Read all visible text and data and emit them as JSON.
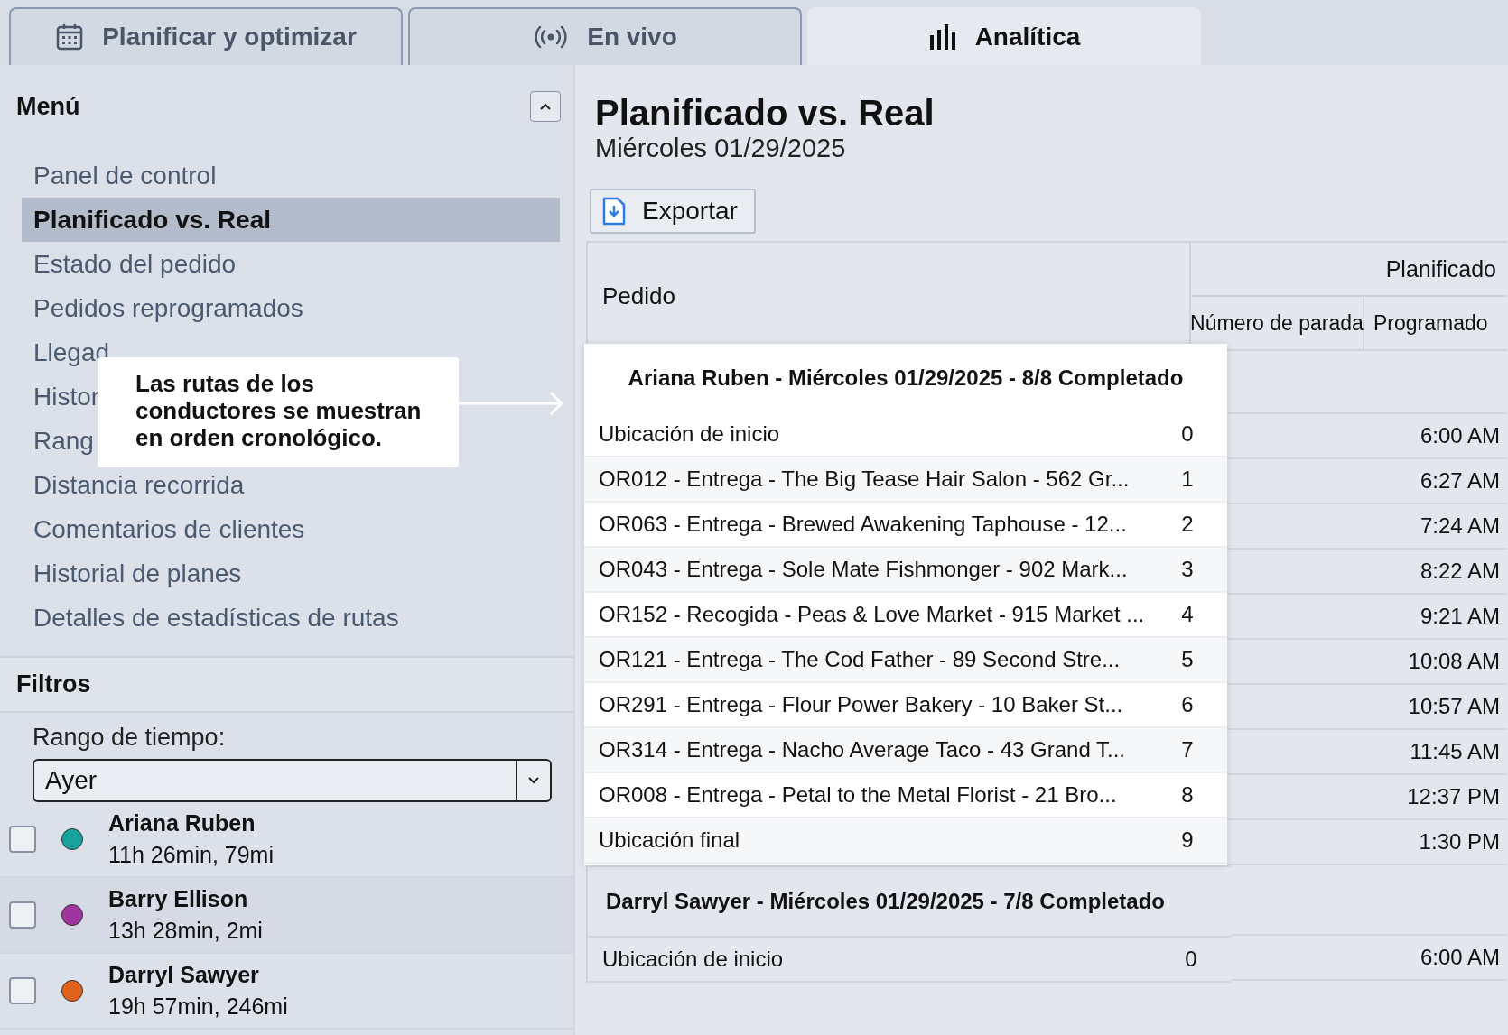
{
  "tabs": [
    {
      "label": "Planificar y optimizar",
      "kind": "calendar",
      "selected": false
    },
    {
      "label": "En vivo",
      "kind": "broadcast",
      "selected": false
    },
    {
      "label": "Analítica",
      "kind": "bars",
      "selected": true
    }
  ],
  "sidebar": {
    "title": "Menú",
    "expanded": true,
    "items": [
      {
        "label": "Panel de control",
        "selected": false
      },
      {
        "label": "Planificado vs. Real",
        "selected": true
      },
      {
        "label": "Estado del pedido",
        "selected": false
      },
      {
        "label": "Pedidos reprogramados",
        "selected": false
      },
      {
        "label": "Llegad",
        "selected": false
      },
      {
        "label": "Histor",
        "selected": false
      },
      {
        "label": "Rang",
        "selected": false
      },
      {
        "label": "Distancia recorrida",
        "selected": false
      },
      {
        "label": "Comentarios de clientes",
        "selected": false
      },
      {
        "label": "Historial de planes",
        "selected": false
      },
      {
        "label": "Detalles de estadísticas de rutas",
        "selected": false
      }
    ],
    "filters": {
      "title": "Filtros",
      "time_range": {
        "label": "Rango de tiempo:",
        "value": "Ayer"
      },
      "drivers": [
        {
          "name": "Ariana Ruben",
          "summary": "11h 26min, 79mi",
          "color": "#17a39c",
          "checked": false
        },
        {
          "name": "Barry Ellison",
          "summary": "13h 28min, 2mi",
          "color": "#a1359f",
          "checked": false
        },
        {
          "name": "Darryl Sawyer",
          "summary": "19h 57min, 246mi",
          "color": "#e0621c",
          "checked": false
        }
      ]
    }
  },
  "callout": {
    "text": "Las rutas de los conductores se muestran en orden cronológico."
  },
  "main": {
    "title": "Planificado vs. Real",
    "subtitle": "Miércoles 01/29/2025",
    "export_button": "Exportar",
    "table": {
      "columns": {
        "order": "Pedido",
        "group": "Planificado",
        "stop": "Número de parada",
        "scheduled": "Programado"
      },
      "groups": [
        {
          "title": "Ariana Ruben - Miércoles 01/29/2025 - 8/8 Completado",
          "highlighted": true,
          "rows": [
            {
              "order": "Ubicación de inicio",
              "stop": "0",
              "time": "6:00 AM"
            },
            {
              "order": "OR012 - Entrega - The Big Tease Hair Salon - 562 Gr...",
              "stop": "1",
              "time": "6:27 AM"
            },
            {
              "order": "OR063 - Entrega - Brewed Awakening Taphouse - 12...",
              "stop": "2",
              "time": "7:24 AM"
            },
            {
              "order": "OR043 - Entrega - Sole Mate Fishmonger - 902 Mark...",
              "stop": "3",
              "time": "8:22 AM"
            },
            {
              "order": "OR152 - Recogida - Peas & Love Market - 915 Market ...",
              "stop": "4",
              "time": "9:21 AM"
            },
            {
              "order": "OR121 - Entrega - The Cod Father - 89 Second Stre...",
              "stop": "5",
              "time": "10:08 AM"
            },
            {
              "order": "OR291 - Entrega - Flour Power Bakery - 10 Baker St...",
              "stop": "6",
              "time": "10:57 AM"
            },
            {
              "order": "OR314 - Entrega - Nacho Average Taco - 43 Grand T...",
              "stop": "7",
              "time": "11:45 AM"
            },
            {
              "order": "OR008 - Entrega - Petal to the Metal Florist - 21 Bro...",
              "stop": "8",
              "time": "12:37 PM"
            },
            {
              "order": "Ubicación final",
              "stop": "9",
              "time": "1:30 PM"
            }
          ]
        },
        {
          "title": "Darryl Sawyer - Miércoles 01/29/2025 - 7/8 Completado",
          "highlighted": false,
          "rows": [
            {
              "order": "Ubicación de inicio",
              "stop": "0",
              "time": "6:00 AM"
            }
          ]
        }
      ]
    }
  }
}
